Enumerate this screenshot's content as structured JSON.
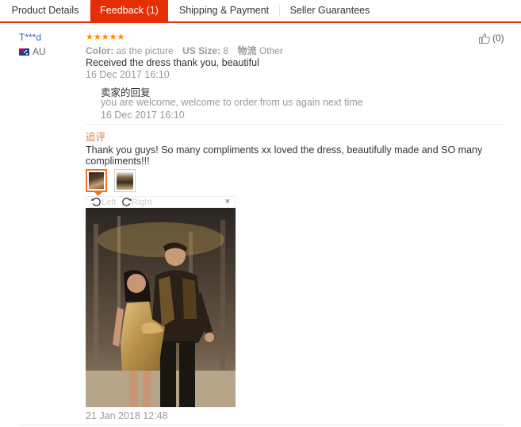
{
  "tabs": [
    {
      "label": "Product Details",
      "active": false
    },
    {
      "label": "Feedback (1)",
      "active": true
    },
    {
      "label": "Shipping & Payment",
      "active": false
    },
    {
      "label": "Seller Guarantees",
      "active": false
    }
  ],
  "feedback": {
    "user_name": "T***d",
    "country": "AU",
    "rating_stars": 5,
    "stars_text": "★★★★★",
    "helpful_count": "(0)",
    "color_label": "Color:",
    "color_value": "as the picture",
    "size_label": "US Size:",
    "size_value": "8",
    "logistics_label": "物流",
    "logistics_value": "Other",
    "text": "Received the dress thank you, beautiful",
    "date": "16 Dec 2017 16:10",
    "seller_reply": {
      "title": "卖家的回复",
      "text": "you are welcome, welcome to order from us again next time",
      "date": "16 Dec 2017 16:10"
    },
    "additional": {
      "label": "追评",
      "text": "Thank you guys! So many compliments xx loved the dress, beautifully made and SO many compliments!!!",
      "rotate_left": "Left",
      "rotate_right": "Right",
      "close": "×",
      "date": "21 Jan 2018 12:48"
    }
  },
  "colors": {
    "accent": "#e62e04",
    "link": "#2d63c8",
    "append": "#f0742a",
    "star": "#ff8a00"
  }
}
